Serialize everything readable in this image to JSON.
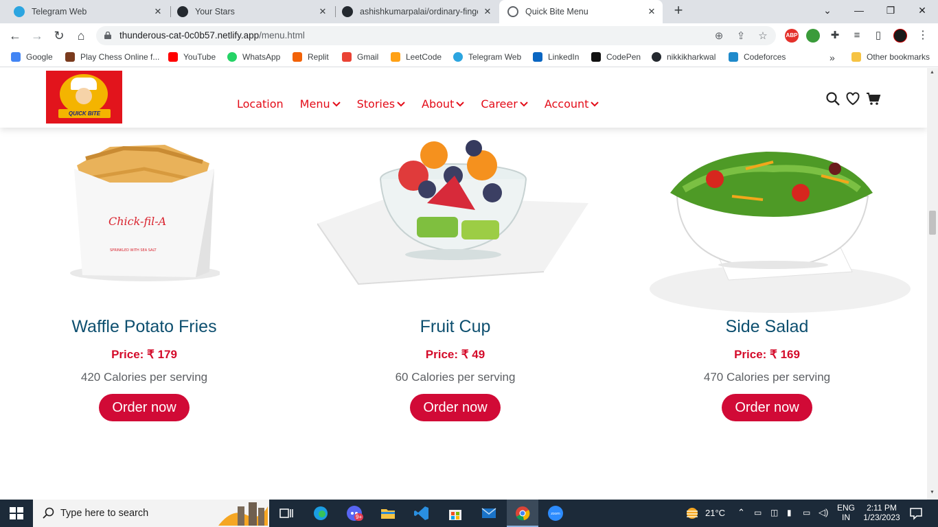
{
  "browser": {
    "tabs": [
      {
        "title": "Telegram Web",
        "icon": "telegram-icon",
        "color": "#2ca5e0"
      },
      {
        "title": "Your Stars",
        "icon": "github-icon",
        "color": "#24292f"
      },
      {
        "title": "ashishkumarpalai/ordinary-finge",
        "icon": "github-icon",
        "color": "#24292f"
      },
      {
        "title": "Quick Bite Menu",
        "icon": "globe-icon",
        "color": "#5f6368"
      }
    ],
    "url_host": "thunderous-cat-0c0b57.netlify.app",
    "url_path": "/menu.html",
    "extensions": [
      {
        "label": "ABP",
        "color": "#e4312b"
      }
    ]
  },
  "bookmarks": [
    {
      "label": "Google",
      "icon": "google-icon",
      "color": "#4285f4"
    },
    {
      "label": "Play Chess Online f...",
      "icon": "chess-icon",
      "color": "#7a3b1e"
    },
    {
      "label": "YouTube",
      "icon": "youtube-icon",
      "color": "#ff0000"
    },
    {
      "label": "WhatsApp",
      "icon": "whatsapp-icon",
      "color": "#25d366"
    },
    {
      "label": "Replit",
      "icon": "replit-icon",
      "color": "#f26207"
    },
    {
      "label": "Gmail",
      "icon": "gmail-icon",
      "color": "#ea4335"
    },
    {
      "label": "LeetCode",
      "icon": "leetcode-icon",
      "color": "#ffa116"
    },
    {
      "label": "Telegram Web",
      "icon": "telegram-icon",
      "color": "#2ca5e0"
    },
    {
      "label": "LinkedIn",
      "icon": "linkedin-icon",
      "color": "#0a66c2"
    },
    {
      "label": "CodePen",
      "icon": "codepen-icon",
      "color": "#111111"
    },
    {
      "label": "nikkikharkwal",
      "icon": "github-icon",
      "color": "#24292f"
    },
    {
      "label": "Codeforces",
      "icon": "codeforces-icon",
      "color": "#1f8acb"
    }
  ],
  "other_bookmarks": "Other bookmarks",
  "site": {
    "logo_text": "QUICK BITE",
    "nav": [
      "Location",
      "Menu",
      "Stories",
      "About",
      "Career",
      "Account"
    ],
    "brand_red": "#e30b17"
  },
  "products": [
    {
      "name": "Waffle Potato Fries",
      "price": "Price: ₹ 179",
      "calories": "420 Calories per serving",
      "cta": "Order now"
    },
    {
      "name": "Fruit Cup",
      "price": "Price: ₹ 49",
      "calories": "60 Calories per serving",
      "cta": "Order now"
    },
    {
      "name": "Side Salad",
      "price": "Price: ₹ 169",
      "calories": "470 Calories per serving",
      "cta": "Order now"
    }
  ],
  "taskbar": {
    "search_placeholder": "Type here to search",
    "weather": "21°C",
    "lang_top": "ENG",
    "lang_bottom": "IN",
    "time": "2:11 PM",
    "date": "1/23/2023",
    "badge": "9+"
  }
}
